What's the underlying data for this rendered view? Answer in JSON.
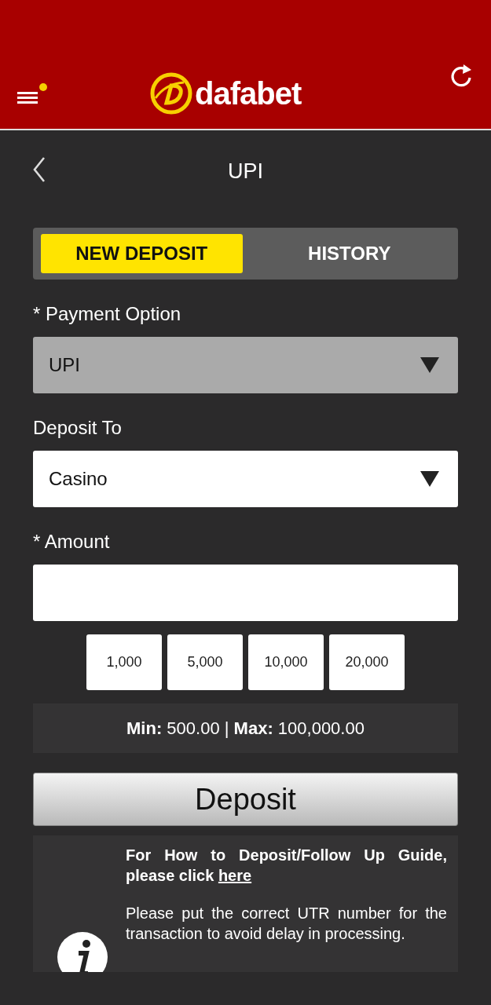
{
  "header": {
    "logo_text": "dafabet",
    "menu_notification": true
  },
  "page": {
    "title": "UPI"
  },
  "tabs": [
    {
      "label": "NEW DEPOSIT",
      "selected": true
    },
    {
      "label": "HISTORY",
      "selected": false
    }
  ],
  "form": {
    "fields": [
      {
        "kind": "select",
        "label": "* Payment Option",
        "value": "UPI",
        "disabled": true
      },
      {
        "kind": "select",
        "label": "Deposit To",
        "value": "Casino",
        "disabled": false
      },
      {
        "kind": "input",
        "label": "* Amount"
      }
    ],
    "quick_amounts": [
      "1,000",
      "5,000",
      "10,000",
      "20,000"
    ],
    "limits": "**Min:** 500.00 | **Max:** 100,000.00",
    "submit": "Deposit"
  },
  "info": {
    "guide_text": "For How to Deposit/Follow Up Guide, please click",
    "guide_link": "here",
    "note": "Please put the correct UTR number for the transaction to avoid delay in processing."
  }
}
